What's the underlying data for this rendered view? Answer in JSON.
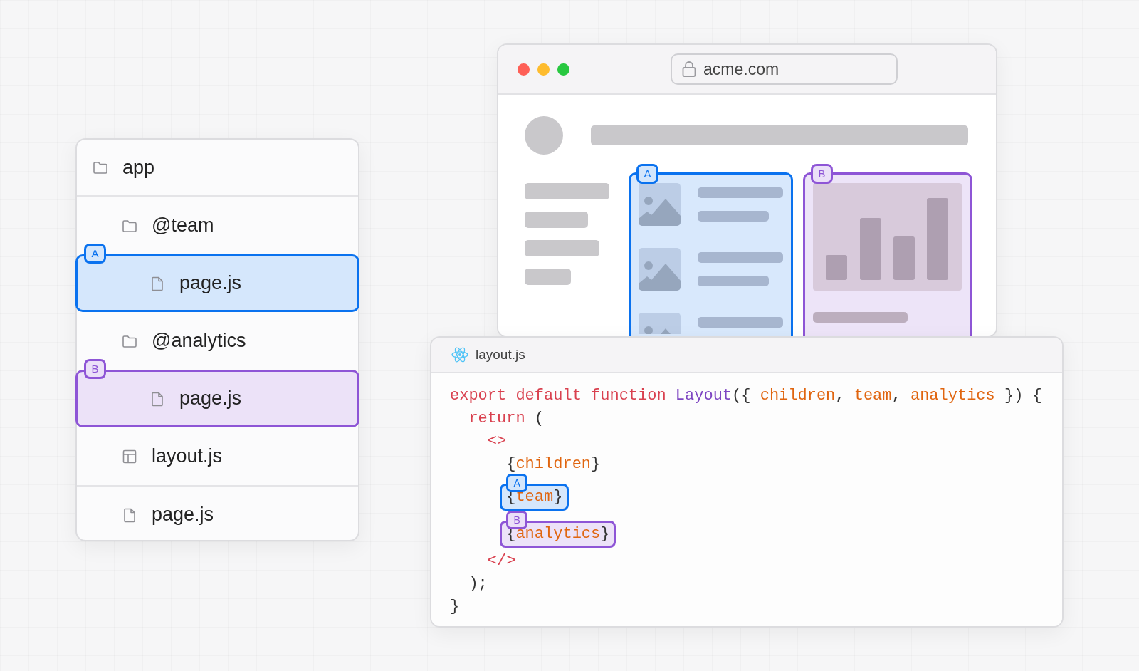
{
  "file_tree": {
    "root": {
      "name": "app",
      "kind": "folder",
      "children": [
        {
          "name": "@team",
          "kind": "folder",
          "children": [
            {
              "name": "page.js",
              "kind": "file",
              "badge": "A",
              "color": "#0a72ef"
            }
          ]
        },
        {
          "name": "@analytics",
          "kind": "folder",
          "children": [
            {
              "name": "page.js",
              "kind": "file",
              "badge": "B",
              "color": "#8e55d6"
            }
          ]
        },
        {
          "name": "layout.js",
          "kind": "layout"
        },
        {
          "name": "page.js",
          "kind": "file"
        }
      ]
    }
  },
  "browser": {
    "url": "acme.com",
    "slots": [
      {
        "badge": "A",
        "color": "#0a72ef",
        "kind": "list"
      },
      {
        "badge": "B",
        "color": "#8e55d6",
        "kind": "chart"
      }
    ]
  },
  "editor": {
    "filename": "layout.js",
    "lines": [
      {
        "tokens": [
          {
            "text": "export default function ",
            "kind": "keyword"
          },
          {
            "text": "Layout",
            "kind": "function"
          },
          {
            "text": "({ ",
            "kind": "plain"
          },
          {
            "text": "children",
            "kind": "param"
          },
          {
            "text": ", ",
            "kind": "plain"
          },
          {
            "text": "team",
            "kind": "param"
          },
          {
            "text": ", ",
            "kind": "plain"
          },
          {
            "text": "analytics",
            "kind": "param"
          },
          {
            "text": " }) {",
            "kind": "plain"
          }
        ]
      },
      {
        "tokens": [
          {
            "text": "  return",
            "kind": "keyword"
          },
          {
            "text": " (",
            "kind": "plain"
          }
        ]
      },
      {
        "tokens": [
          {
            "text": "    <>",
            "kind": "keyword"
          }
        ]
      },
      {
        "tokens": [
          {
            "text": "      {",
            "kind": "plain"
          },
          {
            "text": "children",
            "kind": "param"
          },
          {
            "text": "}",
            "kind": "plain"
          }
        ]
      },
      {
        "tokens": [
          {
            "text": "      {",
            "kind": "plain"
          },
          {
            "text": "team",
            "kind": "param"
          },
          {
            "text": "}",
            "kind": "plain"
          }
        ],
        "badge": "A",
        "color": "#0a72ef"
      },
      {
        "tokens": [
          {
            "text": "      {",
            "kind": "plain"
          },
          {
            "text": "analytics",
            "kind": "param"
          },
          {
            "text": "}",
            "kind": "plain"
          }
        ],
        "badge": "B",
        "color": "#8e55d6"
      },
      {
        "tokens": [
          {
            "text": "    </>",
            "kind": "keyword"
          }
        ]
      },
      {
        "tokens": [
          {
            "text": "  );",
            "kind": "plain"
          }
        ]
      },
      {
        "tokens": [
          {
            "text": "}",
            "kind": "plain"
          }
        ]
      }
    ]
  }
}
